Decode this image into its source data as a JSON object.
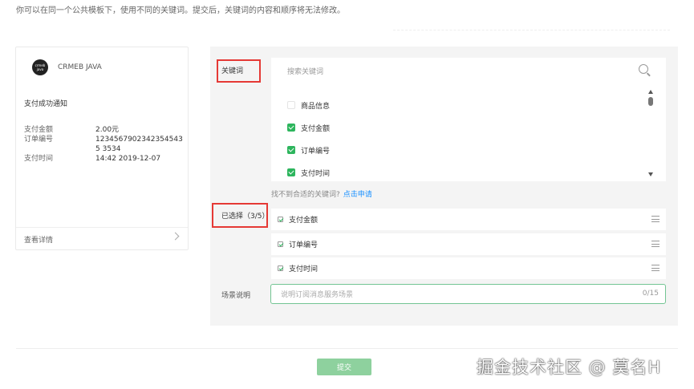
{
  "hint": "你可以在同一个公共模板下，使用不同的关键词。提交后，关键词的内容和顺序将无法修改。",
  "preview": {
    "brand_name": "CRMEB JAVA",
    "logo_text": "crmeb java",
    "template_title": "支付成功通知",
    "rows": [
      {
        "key": "支付金额",
        "value": "2.00元"
      },
      {
        "key": "订单编号",
        "value": "12345679023423545435 3534"
      },
      {
        "key": "支付时间",
        "value": "14:42 2019-12-07"
      }
    ],
    "footer_link": "查看详情"
  },
  "form": {
    "keywords_label": "关键词",
    "search_placeholder": "搜索关键词",
    "keyword_options": [
      {
        "label": "商品信息",
        "checked": false
      },
      {
        "label": "支付金额",
        "checked": true
      },
      {
        "label": "订单编号",
        "checked": true
      },
      {
        "label": "支付时间",
        "checked": true
      }
    ],
    "not_found_text": "找不到合适的关键词?",
    "apply_link": "点击申请",
    "selected_label": "已选择（3/5）",
    "selected_items": [
      "支付金额",
      "订单编号",
      "支付时间"
    ],
    "scene_label": "场景说明",
    "scene_placeholder": "说明订阅消息服务场景",
    "scene_count": "0/15",
    "submit_label": "提交"
  },
  "watermark": "掘金技术社区 @ 莫名H",
  "colors": {
    "accent": "#2db55d",
    "highlight": "#e53935",
    "link": "#1890ff"
  }
}
